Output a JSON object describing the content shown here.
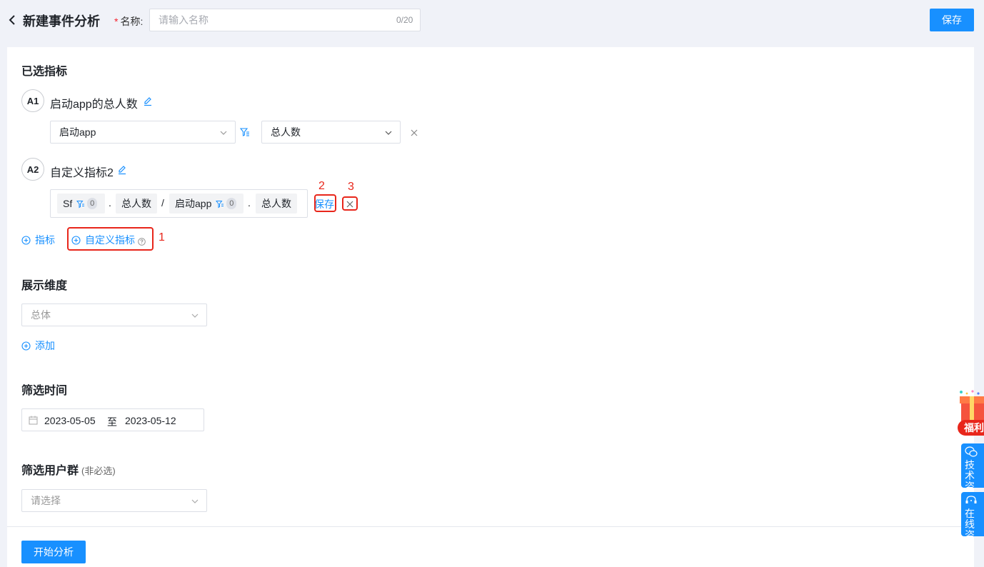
{
  "header": {
    "title": "新建事件分析",
    "name_label": "名称:",
    "name_required": "*",
    "name_placeholder": "请输入名称",
    "name_value": "",
    "name_counter": "0/20",
    "save_label": "保存"
  },
  "metrics": {
    "section_title": "已选指标",
    "items": [
      {
        "badge": "A1",
        "name": "启动app的总人数",
        "event": "启动app",
        "measure": "总人数"
      },
      {
        "badge": "A2",
        "name": "自定义指标2",
        "formula": {
          "token1": "Sf",
          "token1_count": "0",
          "op1": ".",
          "token2": "总人数",
          "op2": "/",
          "token3": "启动app",
          "token3_count": "0",
          "op3": ".",
          "token4": "总人数"
        },
        "save_link": "保存"
      }
    ],
    "add_metric": "指标",
    "add_custom_metric": "自定义指标",
    "annotations": [
      "1",
      "2",
      "3"
    ]
  },
  "dimension": {
    "section_title": "展示维度",
    "selected": "总体",
    "add_label": "添加"
  },
  "time": {
    "section_title": "筛选时间",
    "start": "2023-05-05",
    "separator": "至",
    "end": "2023-05-12"
  },
  "user_group": {
    "section_title": "筛选用户群",
    "optional_note": "(非必选)",
    "placeholder": "请选择"
  },
  "footer": {
    "start_label": "开始分析"
  },
  "floating": {
    "welfare": "福利",
    "tech_consult": "技术咨询",
    "tech_line1": "技术",
    "tech_line2": "咨询",
    "online_line1": "在线",
    "online_line2": "咨询"
  },
  "colors": {
    "primary": "#1890ff",
    "annotation_red": "#e8261b",
    "background": "#f0f2f8"
  }
}
